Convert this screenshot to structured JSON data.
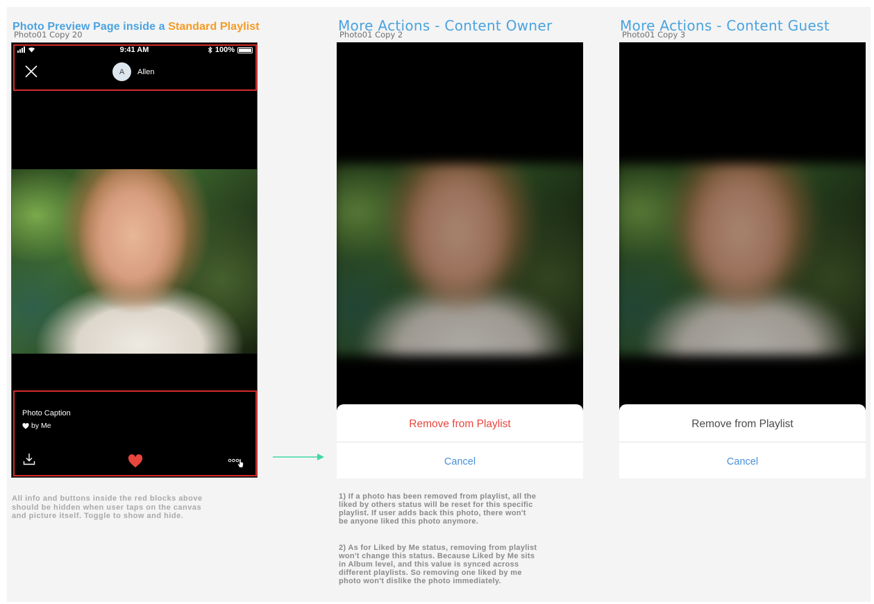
{
  "frames": [
    {
      "heading_prefix": "Photo Preview Page inside a ",
      "heading_highlight": "Standard Playlist",
      "artboard_label": "Photo01 Copy 20"
    },
    {
      "heading": "More Actions - Content Owner",
      "artboard_label": "Photo01 Copy 2"
    },
    {
      "heading": "More Actions - Content Guest",
      "artboard_label": "Photo01 Copy 3"
    }
  ],
  "status_bar": {
    "time": "9:41 AM",
    "battery": "100%"
  },
  "preview": {
    "avatar_initial": "A",
    "user_name": "Allen",
    "caption": "Photo Caption",
    "liked_text": "by Me"
  },
  "owner_sheet": {
    "primary_action": "Remove from Playlist",
    "cancel": "Cancel"
  },
  "guest_sheet": {
    "primary_action": "Remove from Playlist",
    "cancel": "Cancel"
  },
  "notes": {
    "left": [
      "All info and buttons inside the red blocks above",
      "should be hidden when user taps on the canvas",
      "and picture itself. Toggle to show and hide."
    ],
    "middle_1": [
      "1) If a photo has been removed from playlist, all the",
      "liked by others status will be reset for this specific",
      "playlist. If user adds back this photo, there won't",
      "be anyone liked this photo anymore."
    ],
    "middle_2": [
      "2) As for Liked by Me status, removing from playlist",
      "won't change this status. Because Liked by Me sits",
      "in Album level, and this value is synced across",
      "different playlists. So removing one liked by me",
      "photo won't dislike the photo immediately."
    ]
  },
  "colors": {
    "heading_blue": "#4aa3df",
    "highlight_orange": "#f59a23",
    "red_block": "#d62b2b",
    "destructive_red": "#e8453c",
    "ios_blue": "#4a90d9",
    "heart_red": "#e8453c",
    "arrow_green": "#3fd8a8"
  }
}
